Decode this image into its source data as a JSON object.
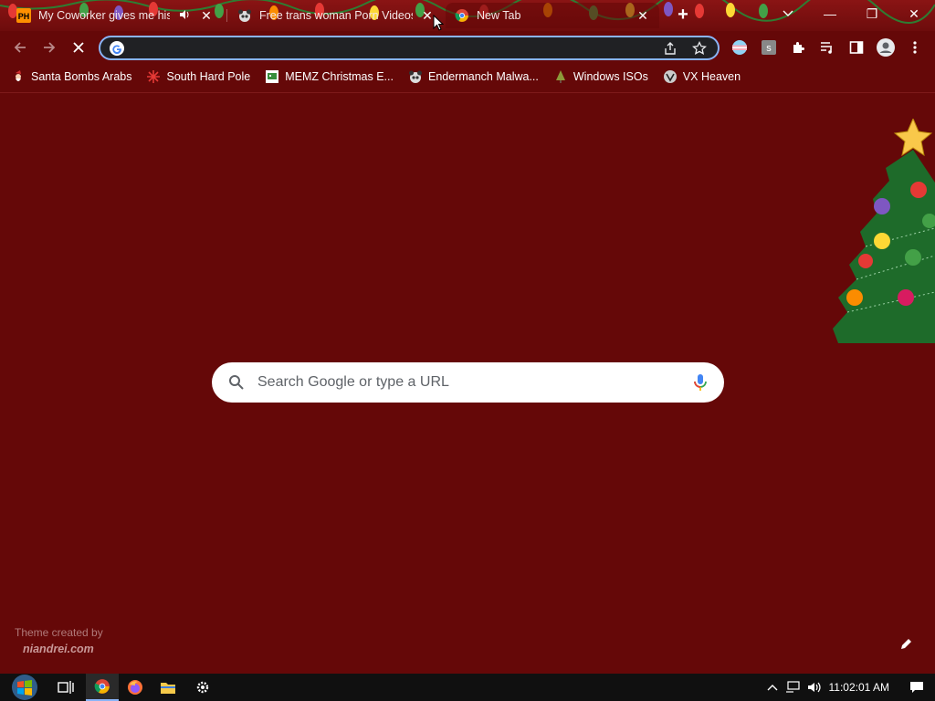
{
  "tabs": [
    {
      "title": "My Coworker gives me his C",
      "favicon": "PH",
      "muted_icon": "speaker-icon"
    },
    {
      "title": "Free trans woman Porn Videos: t",
      "favicon": "panda"
    },
    {
      "title": "New Tab",
      "favicon": "chrome"
    }
  ],
  "tabstrip": {
    "new_tab_symbol": "+",
    "tab_search_symbol": "⌵",
    "close_symbol": "✕"
  },
  "window_controls": {
    "minimize": "—",
    "restore": "❐",
    "close": "✕"
  },
  "omnibox": {
    "value": "",
    "placeholder": ""
  },
  "bookmarks": [
    {
      "label": "Santa Bombs Arabs",
      "icon": "santa"
    },
    {
      "label": "South Hard Pole",
      "icon": "snowflake"
    },
    {
      "label": "MEMZ Christmas E...",
      "icon": "memz"
    },
    {
      "label": "Endermanch Malwa...",
      "icon": "panda"
    },
    {
      "label": "Windows ISOs",
      "icon": "tree"
    },
    {
      "label": "VX Heaven",
      "icon": "vx"
    }
  ],
  "search": {
    "placeholder": "Search Google or type a URL"
  },
  "theme_credit": {
    "line1": "Theme created by",
    "line2": "niandrei.com"
  },
  "taskbar": {
    "time": "11:02:01 AM"
  },
  "colors": {
    "theme_bg": "#650808",
    "omnibox_bg": "#202124",
    "focus_ring": "#8ab4f8",
    "taskbar_bg": "#101010"
  }
}
